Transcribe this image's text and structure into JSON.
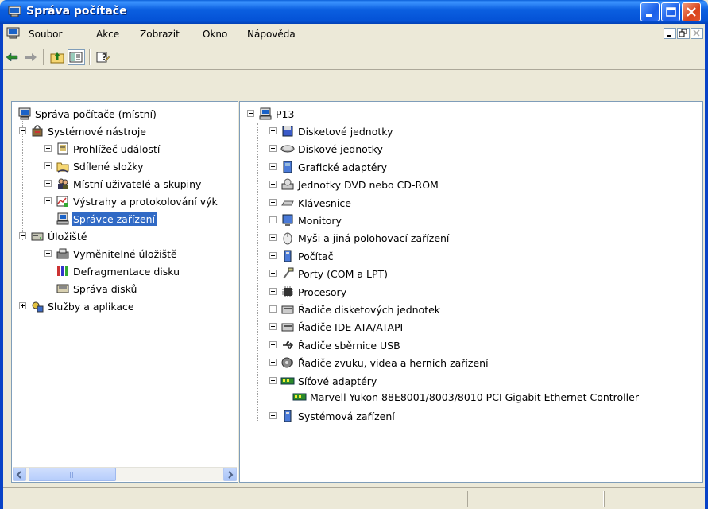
{
  "window": {
    "title": "Správa počítače"
  },
  "menubar": {
    "items": [
      "Soubor",
      "Akce",
      "Zobrazit",
      "Okno",
      "Nápověda"
    ]
  },
  "toolbar": {
    "buttons": [
      "back-icon",
      "forward-icon",
      "up-level-icon",
      "show-hide-tree-icon",
      "help-icon"
    ]
  },
  "left_tree": {
    "root": "Správa počítače (místní)",
    "system_tools": "Systémové nástroje",
    "event_viewer": "Prohlížeč událostí",
    "shared_folders": "Sdílené složky",
    "local_users": "Místní uživatelé a skupiny",
    "perf_logs": "Výstrahy a protokolování výk",
    "device_manager": "Správce zařízení",
    "storage": "Úložiště",
    "removable_storage": "Vyměnitelné úložiště",
    "defrag": "Defragmentace disku",
    "disk_mgmt": "Správa disků",
    "services_apps": "Služby a aplikace"
  },
  "right_tree": {
    "computer": "P13",
    "items": [
      "Disketové jednotky",
      "Diskové jednotky",
      "Grafické adaptéry",
      "Jednotky DVD nebo CD-ROM",
      "Klávesnice",
      "Monitory",
      "Myši a jiná polohovací zařízení",
      "Počítač",
      "Porty (COM a LPT)",
      "Procesory",
      "Řadiče disketových jednotek",
      "Řadiče IDE ATA/ATAPI",
      "Řadiče sběrnice USB",
      "Řadiče zvuku, videa a herních zařízení",
      "Síťové adaptéry",
      "Systémová zařízení"
    ],
    "network_child": "Marvell Yukon 88E8001/8003/8010 PCI Gigabit Ethernet Controller"
  },
  "colors": {
    "titlebar": "#0452d6",
    "selection": "#316ac5",
    "face": "#ece9d8"
  }
}
